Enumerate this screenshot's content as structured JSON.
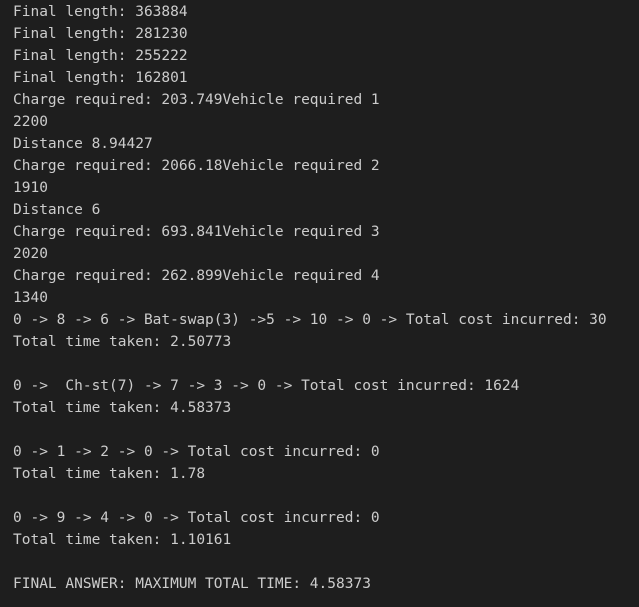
{
  "terminal": {
    "lines": [
      "Final length: 363884",
      "Final length: 281230",
      "Final length: 255222",
      "Final length: 162801",
      "Charge required: 203.749Vehicle required 1",
      "2200",
      "Distance 8.94427",
      "Charge required: 2066.18Vehicle required 2",
      "1910",
      "Distance 6",
      "Charge required: 693.841Vehicle required 3",
      "2020",
      "Charge required: 262.899Vehicle required 4",
      "1340",
      "0 -> 8 -> 6 -> Bat-swap(3) ->5 -> 10 -> 0 -> Total cost incurred: 30",
      "Total time taken: 2.50773",
      "",
      "0 ->  Ch-st(7) -> 7 -> 3 -> 0 -> Total cost incurred: 1624",
      "Total time taken: 4.58373",
      "",
      "0 -> 1 -> 2 -> 0 -> Total cost incurred: 0",
      "Total time taken: 1.78",
      "",
      "0 -> 9 -> 4 -> 0 -> Total cost incurred: 0",
      "Total time taken: 1.10161",
      "",
      "FINAL ANSWER: MAXIMUM TOTAL TIME: 4.58373"
    ]
  }
}
